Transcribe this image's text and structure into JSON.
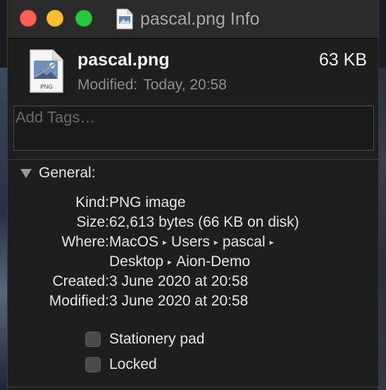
{
  "window": {
    "title": "pascal.png Info"
  },
  "file": {
    "name": "pascal.png",
    "size": "63 KB",
    "modified_label": "Modified:",
    "modified_value": "Today, 20:58",
    "icon_caption": "PNG"
  },
  "tags": {
    "placeholder": "Add Tags…"
  },
  "general": {
    "title": "General:",
    "kind_label": "Kind:",
    "kind_value": "PNG image",
    "size_label": "Size:",
    "size_value": "62,613 bytes (66 KB on disk)",
    "where_label": "Where:",
    "where_path": [
      "MacOS",
      "Users",
      "pascal",
      "Desktop",
      "Aion-Demo"
    ],
    "created_label": "Created:",
    "created_value": "3 June 2020 at 20:58",
    "modified_label": "Modified:",
    "modified_value": "3 June 2020 at 20:58"
  },
  "options": {
    "stationery_label": "Stationery pad",
    "stationery_checked": false,
    "locked_label": "Locked",
    "locked_checked": false
  },
  "colors": {
    "close": "#ff5f57",
    "minimize": "#febc2e",
    "zoom": "#28c840"
  }
}
